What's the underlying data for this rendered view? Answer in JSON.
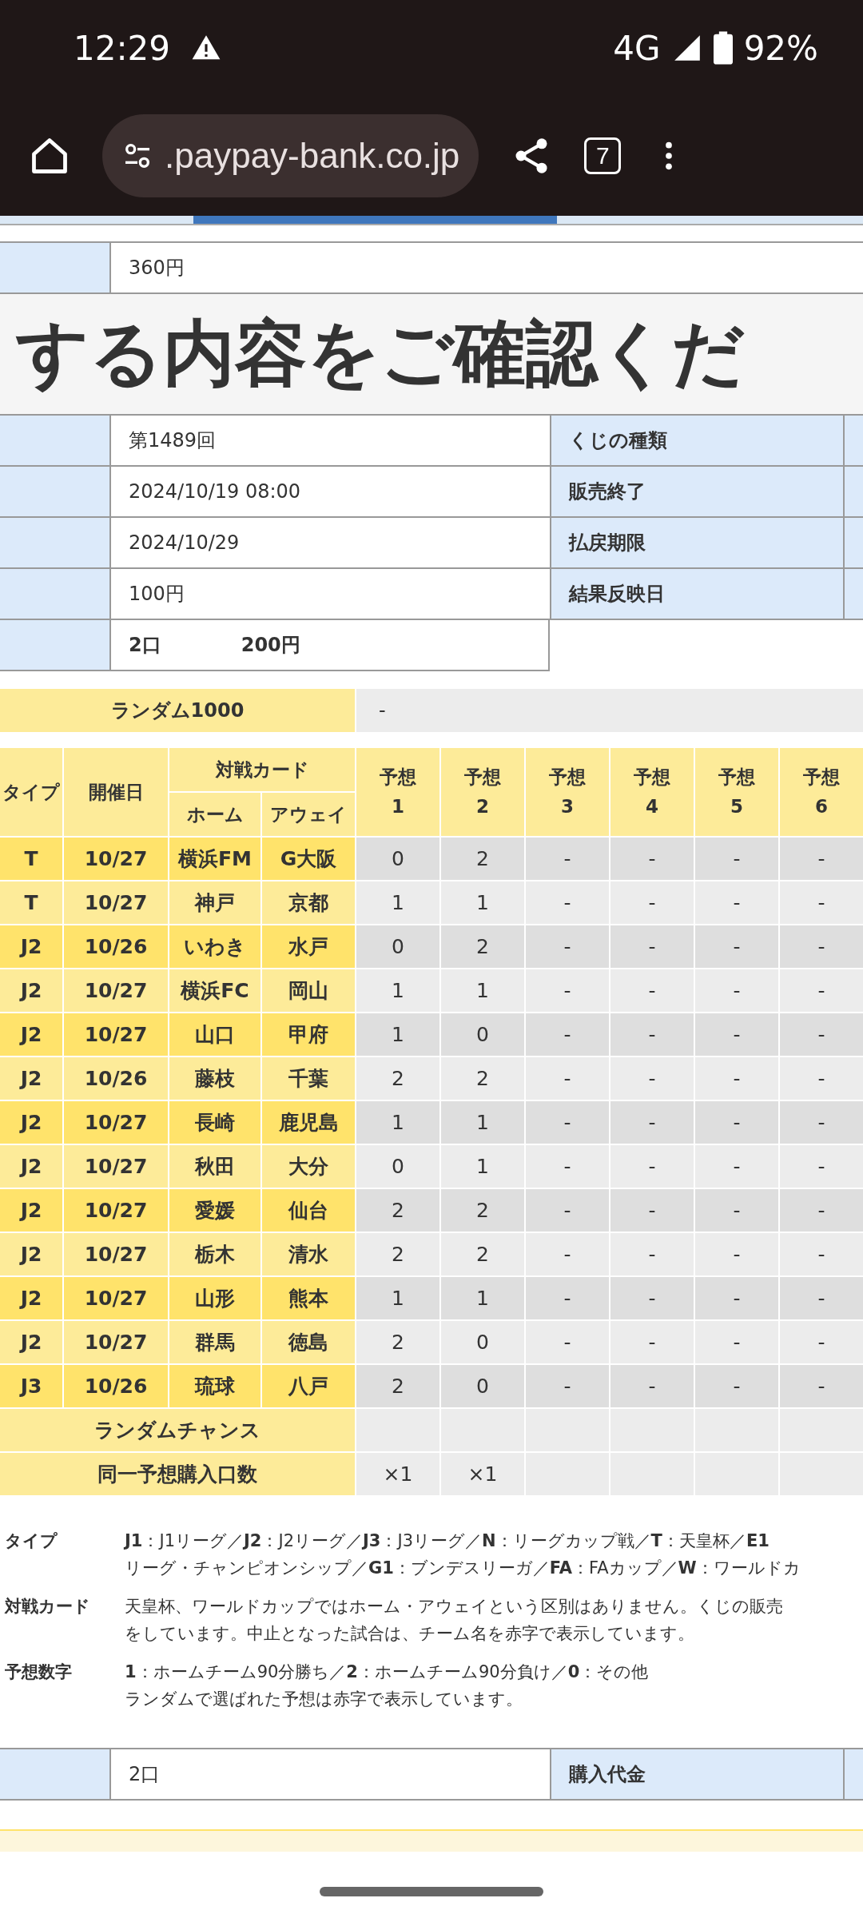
{
  "status_bar": {
    "time": "12:29",
    "network": "4G",
    "battery": "92%"
  },
  "browser": {
    "url": ".paypay-bank.co.jp",
    "tab_count": "7"
  },
  "steps": [
    {
      "selected": false
    },
    {
      "selected": true
    },
    {
      "selected": false
    }
  ],
  "top_row": {
    "value": "360円"
  },
  "heading": "する内容をご確認くだ",
  "info_rows": [
    {
      "value": "第1489回",
      "label": "くじの種類"
    },
    {
      "value": "2024/10/19 08:00",
      "label": "販売終了"
    },
    {
      "value": "2024/10/29",
      "label": "払戻期限"
    },
    {
      "value": "100円",
      "label": "結果反映日"
    }
  ],
  "total_row": {
    "count": "2口",
    "amount": "200円"
  },
  "random_1000": {
    "label": "ランダム1000",
    "value": "-"
  },
  "table": {
    "headers": {
      "type": "タイプ",
      "date": "開催日",
      "match": "対戦カード",
      "home": "ホーム",
      "away": "アウェイ",
      "predictions": [
        {
          "label": "予想",
          "number": "1"
        },
        {
          "label": "予想",
          "number": "2"
        },
        {
          "label": "予想",
          "number": "3"
        },
        {
          "label": "予想",
          "number": "4"
        },
        {
          "label": "予想",
          "number": "5"
        },
        {
          "label": "予想",
          "number": "6"
        }
      ]
    },
    "rows": [
      {
        "type": "T",
        "date": "10/27",
        "home": "横浜FM",
        "away": "G大阪",
        "predictions": [
          "0",
          "2",
          "-",
          "-",
          "-",
          "-"
        ]
      },
      {
        "type": "T",
        "date": "10/27",
        "home": "神戸",
        "away": "京都",
        "predictions": [
          "1",
          "1",
          "-",
          "-",
          "-",
          "-"
        ]
      },
      {
        "type": "J2",
        "date": "10/26",
        "home": "いわき",
        "away": "水戸",
        "predictions": [
          "0",
          "2",
          "-",
          "-",
          "-",
          "-"
        ]
      },
      {
        "type": "J2",
        "date": "10/27",
        "home": "横浜FC",
        "away": "岡山",
        "predictions": [
          "1",
          "1",
          "-",
          "-",
          "-",
          "-"
        ]
      },
      {
        "type": "J2",
        "date": "10/27",
        "home": "山口",
        "away": "甲府",
        "predictions": [
          "1",
          "0",
          "-",
          "-",
          "-",
          "-"
        ]
      },
      {
        "type": "J2",
        "date": "10/26",
        "home": "藤枝",
        "away": "千葉",
        "predictions": [
          "2",
          "2",
          "-",
          "-",
          "-",
          "-"
        ]
      },
      {
        "type": "J2",
        "date": "10/27",
        "home": "長崎",
        "away": "鹿児島",
        "predictions": [
          "1",
          "1",
          "-",
          "-",
          "-",
          "-"
        ]
      },
      {
        "type": "J2",
        "date": "10/27",
        "home": "秋田",
        "away": "大分",
        "predictions": [
          "0",
          "1",
          "-",
          "-",
          "-",
          "-"
        ]
      },
      {
        "type": "J2",
        "date": "10/27",
        "home": "愛媛",
        "away": "仙台",
        "predictions": [
          "2",
          "2",
          "-",
          "-",
          "-",
          "-"
        ]
      },
      {
        "type": "J2",
        "date": "10/27",
        "home": "栃木",
        "away": "清水",
        "predictions": [
          "2",
          "2",
          "-",
          "-",
          "-",
          "-"
        ]
      },
      {
        "type": "J2",
        "date": "10/27",
        "home": "山形",
        "away": "熊本",
        "predictions": [
          "1",
          "1",
          "-",
          "-",
          "-",
          "-"
        ]
      },
      {
        "type": "J2",
        "date": "10/27",
        "home": "群馬",
        "away": "徳島",
        "predictions": [
          "2",
          "0",
          "-",
          "-",
          "-",
          "-"
        ]
      },
      {
        "type": "J3",
        "date": "10/26",
        "home": "琉球",
        "away": "八戸",
        "predictions": [
          "2",
          "0",
          "-",
          "-",
          "-",
          "-"
        ]
      }
    ],
    "random_chance": {
      "label": "ランダムチャンス"
    },
    "same_purchase": {
      "label": "同一予想購入口数",
      "values": [
        "×1",
        "×1"
      ]
    }
  },
  "legend": [
    {
      "term": "タイプ",
      "lines": [
        "**J1**：J1リーグ／**J2**：J2リーグ／**J3**：J3リーグ／**N**：リーグカップ戦／**T**：天皇杯／**E1**",
        "リーグ・チャンピオンシップ／**G1**：ブンデスリーガ／**FA**：FAカップ／**W**：ワールドカ"
      ]
    },
    {
      "term": "対戦カード",
      "lines": [
        "天皇杯、ワールドカップではホーム・アウェイという区別はありません。くじの販売",
        "をしています。中止となった試合は、チーム名を赤字で表示しています。"
      ]
    },
    {
      "term": "予想数字",
      "lines": [
        "**1**：ホームチーム90分勝ち／**2**：ホームチーム90分負け／**0**：その他",
        "ランダムで選ばれた予想は赤字で表示しています。"
      ]
    }
  ],
  "bottom_row": {
    "value": "2口",
    "label": "購入代金"
  }
}
